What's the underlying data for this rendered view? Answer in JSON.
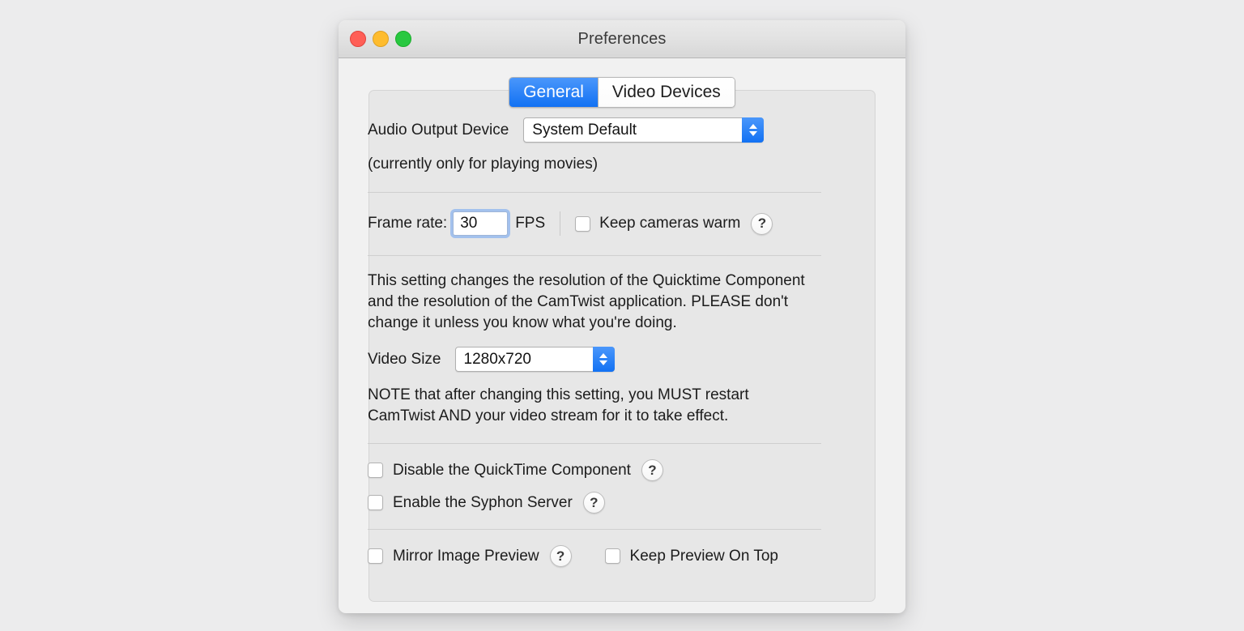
{
  "window": {
    "title": "Preferences",
    "controls": {
      "close": "close-button",
      "minimize": "minimize-button",
      "zoom": "zoom-button"
    }
  },
  "tabs": [
    {
      "label": "General",
      "active": true
    },
    {
      "label": "Video Devices",
      "active": false
    }
  ],
  "general": {
    "audio_output": {
      "label": "Audio Output Device",
      "value": "System Default",
      "note": "(currently only for playing movies)"
    },
    "frame_rate": {
      "label": "Frame rate:",
      "value": "30",
      "unit": "FPS",
      "keep_cameras_warm": {
        "label": "Keep cameras warm",
        "checked": false,
        "help": "?"
      }
    },
    "resolution_note": "This setting changes the resolution of the Quicktime Component and the resolution of the CamTwist application.  PLEASE don't change it unless you know what you're doing.",
    "video_size": {
      "label": "Video Size",
      "value": "1280x720"
    },
    "restart_note": "NOTE that after changing this setting, you MUST restart CamTwist AND your video stream for it to take effect.",
    "checkboxes": [
      {
        "label": "Disable the QuickTime Component",
        "checked": false,
        "help": "?"
      },
      {
        "label": "Enable the Syphon Server",
        "checked": false,
        "help": "?"
      }
    ],
    "preview_options": [
      {
        "label": "Mirror Image Preview",
        "checked": false,
        "help": "?"
      },
      {
        "label": "Keep Preview On Top",
        "checked": false,
        "help": null
      }
    ]
  },
  "colors": {
    "accent_blue": "#1271f3",
    "close_red": "#ff5f57",
    "minimize_yellow": "#febc2e",
    "zoom_green": "#28c840",
    "window_bg": "#f1f1f1",
    "panel_bg": "#e7e7e7"
  }
}
